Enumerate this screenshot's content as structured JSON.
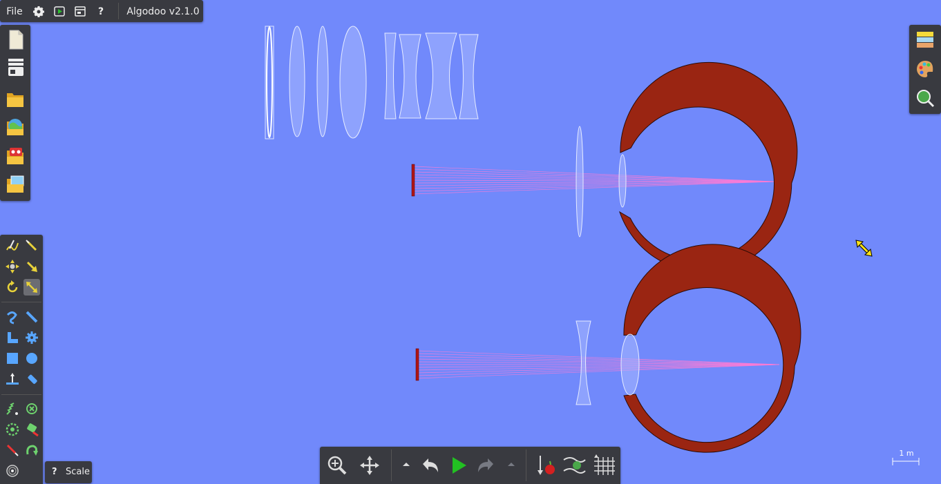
{
  "app": {
    "menu_file": "File",
    "title": "Algodoo v2.1.0"
  },
  "topbar_icons": [
    "gear-icon",
    "play-scene-icon",
    "window-icon",
    "help-icon"
  ],
  "file_panel": [
    "new-file-icon",
    "storage-icon",
    "open-folder-icon",
    "algobox-icon",
    "open-phunlet-icon",
    "open-image-icon"
  ],
  "tools": [
    "sketch-tool",
    "cut-tool",
    "move-tool",
    "drag-tool",
    "rotate-tool",
    "scale-tool",
    "chain-tool",
    "knife-tool",
    "plane-tool",
    "gear-tool",
    "box-tool",
    "circle-tool",
    "fixate-tool",
    "tracer-tool",
    "spring-tool",
    "hinge-tool",
    "thruster-tool",
    "laser-tool",
    "pen-tool",
    "loop-tool",
    "brush-tool"
  ],
  "active_tool": "scale-tool",
  "tool_help": {
    "icon": "?",
    "label": "Scale"
  },
  "right_panel": [
    "layers-icon",
    "palette-icon",
    "zoom-scene-icon"
  ],
  "bottom_toolbar": [
    "zoom-button",
    "pan-button",
    "undo-menu-arrow",
    "undo-button",
    "play-button",
    "redo-button",
    "redo-menu-arrow",
    "gravity-button",
    "air-friction-button",
    "grid-button"
  ],
  "scale_indicator": "1 m",
  "colors": {
    "background": "#7189fb",
    "panel": "#393a40",
    "eye_wall": "#9a2512",
    "laser": "#ff7bd5",
    "play_green": "#22c022",
    "cursor": "#ffe21a"
  }
}
